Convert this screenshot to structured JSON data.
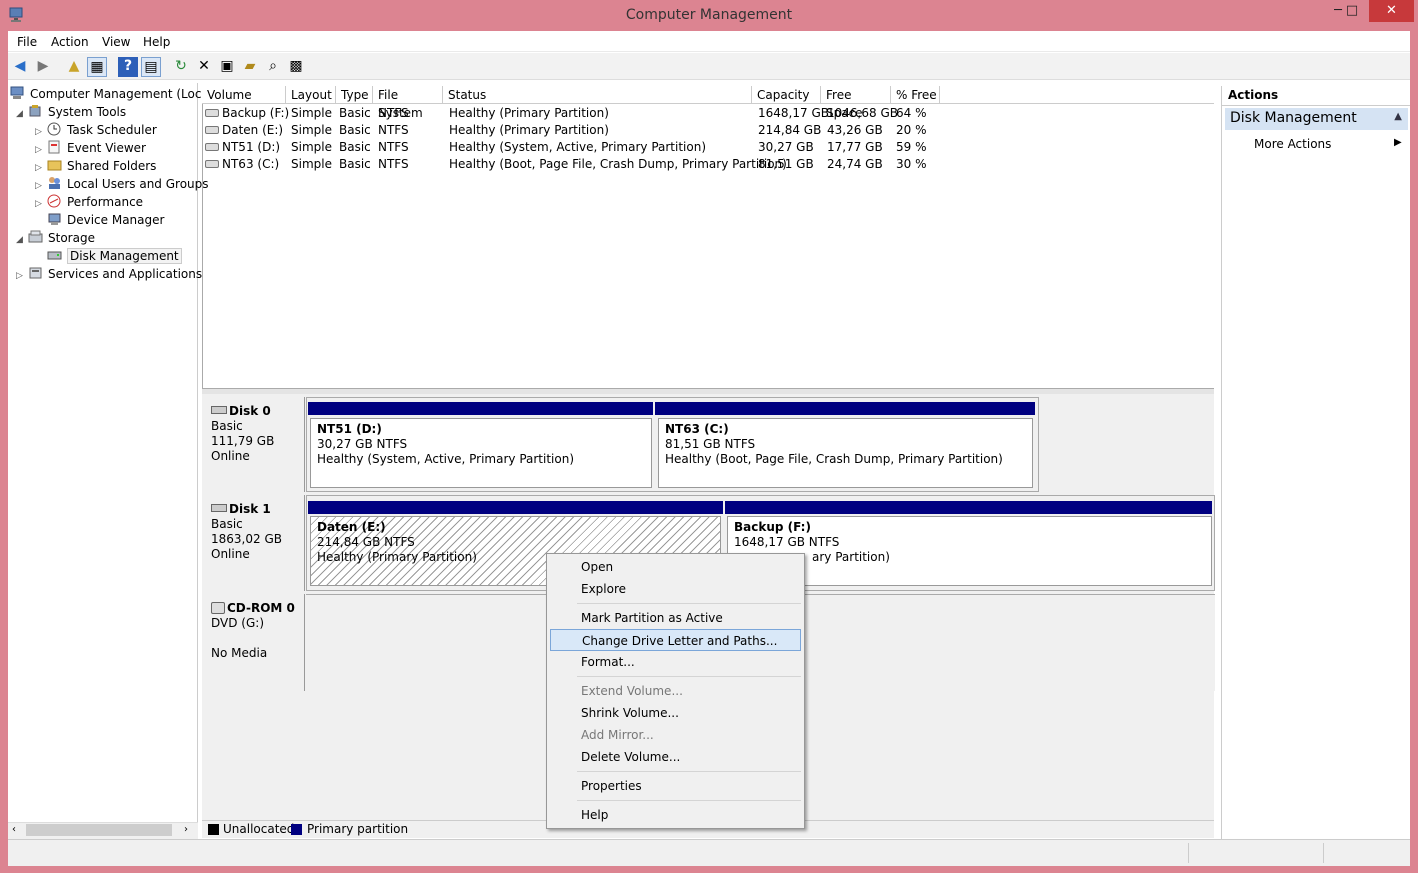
{
  "window": {
    "title": "Computer Management",
    "min": "─",
    "max": "□",
    "close": "✕"
  },
  "menu": [
    "File",
    "Action",
    "View",
    "Help"
  ],
  "toolbar_icons": [
    "back-icon",
    "forward-icon",
    "up-icon",
    "show-hide-tree-icon",
    "help-icon",
    "properties-view-icon",
    "refresh-icon",
    "delete-icon",
    "properties-icon",
    "open-icon",
    "search-icon",
    "export-icon"
  ],
  "tree": {
    "root": "Computer Management (Local",
    "system_tools": "System Tools",
    "task_scheduler": "Task Scheduler",
    "event_viewer": "Event Viewer",
    "shared_folders": "Shared Folders",
    "local_users": "Local Users and Groups",
    "performance": "Performance",
    "device_manager": "Device Manager",
    "storage": "Storage",
    "disk_management": "Disk Management",
    "services": "Services and Applications"
  },
  "volume_table": {
    "columns": [
      "Volume",
      "Layout",
      "Type",
      "File System",
      "Status",
      "Capacity",
      "Free Space",
      "% Free"
    ],
    "rows": [
      [
        "Backup (F:)",
        "Simple",
        "Basic",
        "NTFS",
        "Healthy (Primary Partition)",
        "1648,17 GB",
        "1046,68 GB",
        "64 %"
      ],
      [
        "Daten (E:)",
        "Simple",
        "Basic",
        "NTFS",
        "Healthy (Primary Partition)",
        "214,84 GB",
        "43,26 GB",
        "20 %"
      ],
      [
        "NT51 (D:)",
        "Simple",
        "Basic",
        "NTFS",
        "Healthy (System, Active, Primary Partition)",
        "30,27 GB",
        "17,77 GB",
        "59 %"
      ],
      [
        "NT63 (C:)",
        "Simple",
        "Basic",
        "NTFS",
        "Healthy (Boot, Page File, Crash Dump, Primary Partition)",
        "81,51 GB",
        "24,74 GB",
        "30 %"
      ]
    ]
  },
  "disks": {
    "disk0": {
      "name": "Disk 0",
      "type": "Basic",
      "size": "111,79 GB",
      "state": "Online",
      "p1": {
        "name": "NT51  (D:)",
        "size": "30,27 GB NTFS",
        "status": "Healthy (System, Active, Primary Partition)"
      },
      "p2": {
        "name": "NT63  (C:)",
        "size": "81,51 GB NTFS",
        "status": "Healthy (Boot, Page File, Crash Dump, Primary Partition)"
      }
    },
    "disk1": {
      "name": "Disk 1",
      "type": "Basic",
      "size": "1863,02 GB",
      "state": "Online",
      "p1": {
        "name": "Daten  (E:)",
        "size": "214,84 GB NTFS",
        "status": "Healthy (Primary Partition)"
      },
      "p2": {
        "name": "Backup  (F:)",
        "size": "1648,17 GB NTFS",
        "status": "ary Partition)"
      }
    },
    "cdrom0": {
      "name": "CD-ROM 0",
      "type": "DVD (G:)",
      "state": "No Media"
    }
  },
  "legend": {
    "unallocated": "Unallocated",
    "primary": "Primary partition",
    "unallocated_color": "#000000",
    "primary_color": "#000080"
  },
  "actions": {
    "header": "Actions",
    "section": "Disk Management",
    "more": "More Actions"
  },
  "context_menu": {
    "open": "Open",
    "explore": "Explore",
    "mark_active": "Mark Partition as Active",
    "change_letter": "Change Drive Letter and Paths...",
    "format": "Format...",
    "extend": "Extend Volume...",
    "shrink": "Shrink Volume...",
    "add_mirror": "Add Mirror...",
    "delete": "Delete Volume...",
    "properties": "Properties",
    "help": "Help"
  }
}
